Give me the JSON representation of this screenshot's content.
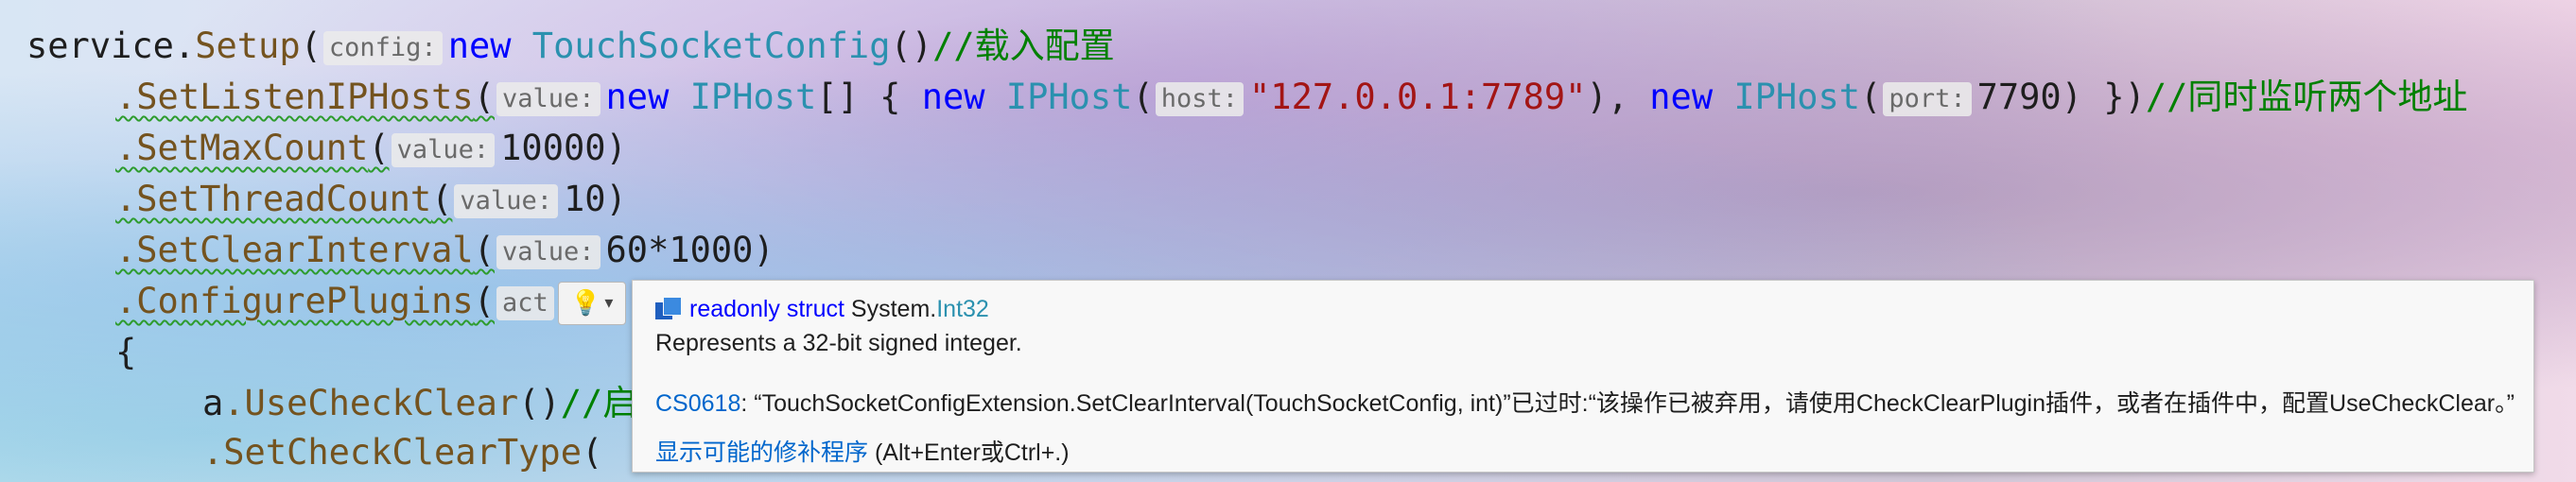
{
  "code": {
    "line1": {
      "receiver": "service",
      "dot": ".",
      "method": "Setup",
      "open": "(",
      "hint": "config:",
      "kw_new": "new",
      "type": "TouchSocketConfig",
      "close": "()",
      "comment": "//载入配置"
    },
    "line2": {
      "method": ".SetListenIPHosts",
      "open": "(",
      "hint1": "value:",
      "kw_new1": "new",
      "type1": "IPHost",
      "array": "[] { ",
      "kw_new2": "new",
      "type2": "IPHost",
      "open2": "(",
      "hint2": "host:",
      "str": "\"127.0.0.1:7789\"",
      "sep": "), ",
      "kw_new3": "new",
      "type3": "IPHost",
      "open3": "(",
      "hint3": "port:",
      "num": "7790",
      "close": ") })",
      "comment": "//同时监听两个地址"
    },
    "line3": {
      "method": ".SetMaxCount",
      "open": "(",
      "hint": "value:",
      "value": "10000",
      "close": ")"
    },
    "line4": {
      "method": ".SetThreadCount",
      "open": "(",
      "hint": "value:",
      "value": "10",
      "close": ")"
    },
    "line5": {
      "method": ".SetClearInterval",
      "open": "(",
      "hint": "value:",
      "value": "60*1000",
      "close": ")"
    },
    "line6": {
      "method": ".ConfigurePlugins",
      "open": "(",
      "hint": "act",
      "after": ":"
    },
    "line7": {
      "text": "{"
    },
    "line8": {
      "receiver": "a",
      "method": ".UseCheckClear",
      "close": "()",
      "comment": "//启"
    },
    "line9": {
      "method": ".SetCheckClearType",
      "open": "("
    }
  },
  "tooltip": {
    "kw": "readonly struct",
    "ns": " System.",
    "type": "Int32",
    "summary": "Represents a 32-bit signed integer.",
    "diag_code": "CS0618",
    "diag_message": ": “TouchSocketConfigExtension.SetClearInterval(TouchSocketConfig, int)”已过时:“该操作已被弃用，请使用CheckClearPlugin插件，或者在插件中，配置UseCheckClear。”",
    "fix_link": "显示可能的修补程序",
    "fix_shortcut": " (Alt+Enter或Ctrl+.)"
  },
  "icons": {
    "lightbulb": "lightbulb-icon",
    "chevron": "chevron-down-icon",
    "struct": "struct-icon"
  }
}
